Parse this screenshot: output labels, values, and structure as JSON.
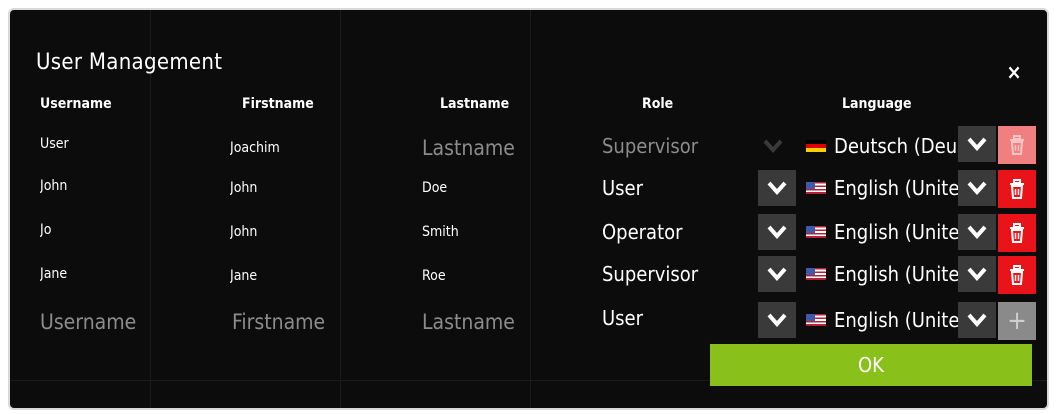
{
  "dialog": {
    "title": "User Management",
    "close_label": "×",
    "ok_label": "OK"
  },
  "columns": {
    "username": "Username",
    "firstname": "Firstname",
    "lastname": "Lastname",
    "role": "Role",
    "language": "Language"
  },
  "rows": [
    {
      "username": "User",
      "firstname": "Joachim",
      "lastname": "Lastname",
      "role": "Supervisor",
      "language": "Deutsch (Deu",
      "flag": "flag-de"
    },
    {
      "username": "John",
      "firstname": "John",
      "lastname": "Doe",
      "role": "User",
      "language": "English (Unite",
      "flag": "flag-us"
    },
    {
      "username": "Jo",
      "firstname": "John",
      "lastname": "Smith",
      "role": "Operator",
      "language": "English (Unite",
      "flag": "flag-us"
    },
    {
      "username": "Jane",
      "firstname": "Jane",
      "lastname": "Roe",
      "role": "Supervisor",
      "language": "English (Unite",
      "flag": "flag-us"
    }
  ],
  "new_row": {
    "username_placeholder": "Username",
    "firstname_placeholder": "Firstname",
    "lastname_placeholder": "Lastname",
    "role": "User",
    "language": "English (Unite",
    "flag": "flag-us",
    "add_label": "+"
  },
  "colors": {
    "delete": "#e8141a",
    "ok": "#8ac01a",
    "background": "#0c0c0c"
  }
}
